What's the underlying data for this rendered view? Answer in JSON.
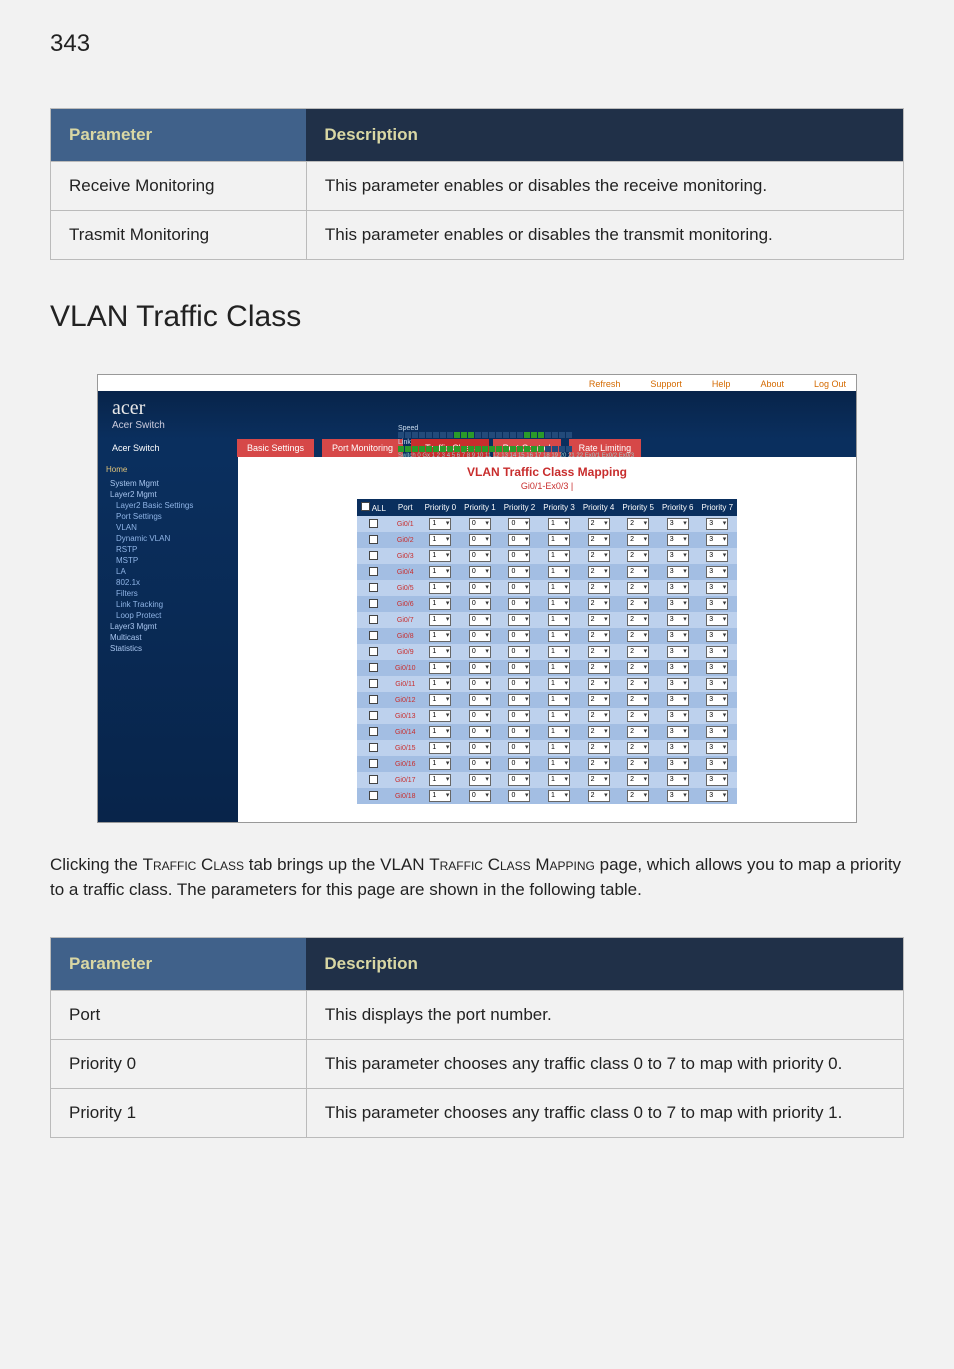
{
  "pageNumber": "343",
  "table1": {
    "headerParam": "Parameter",
    "headerDesc": "Description",
    "rows": [
      {
        "param": "Receive Monitoring",
        "desc": "This parameter enables or disables the receive monitoring."
      },
      {
        "param": "Trasmit Monitoring",
        "desc": "This parameter enables or disables the transmit monitoring."
      }
    ]
  },
  "sectionHeading": "VLAN Traffic Class",
  "screenshot": {
    "topbar": {
      "refresh": "Refresh",
      "support": "Support",
      "help": "Help",
      "about": "About",
      "logout": "Log Out"
    },
    "brand": {
      "line1": "acer",
      "line2": "Acer Switch"
    },
    "portStrip": {
      "speed": "Speed",
      "link": "Link",
      "labels": "Switch 0 Gx 1 2 3 4 5 6 7 8 9 10 11 12 13 14 15 16 17 18 19 20 21 22 Ex0/1 Ex0/2 Ex0/3"
    },
    "tabs": {
      "root": "Acer Switch",
      "basic": "Basic Settings",
      "pm": "Port Monitoring",
      "tc": "Traffic Class",
      "pc": "Port Control",
      "rl": "Rate Limiting"
    },
    "sidebar": {
      "home": "Home",
      "items": [
        "System Mgmt",
        "Layer2 Mgmt"
      ],
      "l2sub": [
        "Layer2 Basic Settings",
        "Port Settings",
        "VLAN",
        "Dynamic VLAN",
        "RSTP",
        "MSTP",
        "LA",
        "802.1x",
        "Filters",
        "Link Tracking",
        "Loop Protect"
      ],
      "l3": "Layer3 Mgmt",
      "mc": "Multicast",
      "st": "Statistics"
    },
    "mapping": {
      "title": "VLAN Traffic Class Mapping",
      "subtitle": "Gi0/1-Ex0/3",
      "allLabel": "ALL",
      "headers": [
        "Port",
        "Priority 0",
        "Priority 1",
        "Priority 2",
        "Priority 3",
        "Priority 4",
        "Priority 5",
        "Priority 6",
        "Priority 7"
      ],
      "rows": [
        {
          "port": "Gi0/1",
          "vals": [
            "1",
            "0",
            "0",
            "1",
            "2",
            "2",
            "3",
            "3"
          ]
        },
        {
          "port": "Gi0/2",
          "vals": [
            "1",
            "0",
            "0",
            "1",
            "2",
            "2",
            "3",
            "3"
          ]
        },
        {
          "port": "Gi0/3",
          "vals": [
            "1",
            "0",
            "0",
            "1",
            "2",
            "2",
            "3",
            "3"
          ]
        },
        {
          "port": "Gi0/4",
          "vals": [
            "1",
            "0",
            "0",
            "1",
            "2",
            "2",
            "3",
            "3"
          ]
        },
        {
          "port": "Gi0/5",
          "vals": [
            "1",
            "0",
            "0",
            "1",
            "2",
            "2",
            "3",
            "3"
          ]
        },
        {
          "port": "Gi0/6",
          "vals": [
            "1",
            "0",
            "0",
            "1",
            "2",
            "2",
            "3",
            "3"
          ]
        },
        {
          "port": "Gi0/7",
          "vals": [
            "1",
            "0",
            "0",
            "1",
            "2",
            "2",
            "3",
            "3"
          ]
        },
        {
          "port": "Gi0/8",
          "vals": [
            "1",
            "0",
            "0",
            "1",
            "2",
            "2",
            "3",
            "3"
          ]
        },
        {
          "port": "Gi0/9",
          "vals": [
            "1",
            "0",
            "0",
            "1",
            "2",
            "2",
            "3",
            "3"
          ]
        },
        {
          "port": "Gi0/10",
          "vals": [
            "1",
            "0",
            "0",
            "1",
            "2",
            "2",
            "3",
            "3"
          ]
        },
        {
          "port": "Gi0/11",
          "vals": [
            "1",
            "0",
            "0",
            "1",
            "2",
            "2",
            "3",
            "3"
          ]
        },
        {
          "port": "Gi0/12",
          "vals": [
            "1",
            "0",
            "0",
            "1",
            "2",
            "2",
            "3",
            "3"
          ]
        },
        {
          "port": "Gi0/13",
          "vals": [
            "1",
            "0",
            "0",
            "1",
            "2",
            "2",
            "3",
            "3"
          ]
        },
        {
          "port": "Gi0/14",
          "vals": [
            "1",
            "0",
            "0",
            "1",
            "2",
            "2",
            "3",
            "3"
          ]
        },
        {
          "port": "Gi0/15",
          "vals": [
            "1",
            "0",
            "0",
            "1",
            "2",
            "2",
            "3",
            "3"
          ]
        },
        {
          "port": "Gi0/16",
          "vals": [
            "1",
            "0",
            "0",
            "1",
            "2",
            "2",
            "3",
            "3"
          ]
        },
        {
          "port": "Gi0/17",
          "vals": [
            "1",
            "0",
            "0",
            "1",
            "2",
            "2",
            "3",
            "3"
          ]
        },
        {
          "port": "Gi0/18",
          "vals": [
            "1",
            "0",
            "0",
            "1",
            "2",
            "2",
            "3",
            "3"
          ]
        }
      ]
    }
  },
  "paragraph": {
    "pre": "Clicking the ",
    "tc1": "Traffic Class",
    "mid": " tab brings up the VLAN ",
    "tc2": "Traffic Class Mapping",
    "post": " page, which allows you to map a priority to a traffic class. The parameters for this page are shown in the following table."
  },
  "table2": {
    "headerParam": "Parameter",
    "headerDesc": "Description",
    "rows": [
      {
        "param": "Port",
        "desc": "This displays the port number."
      },
      {
        "param": "Priority 0",
        "desc": "This parameter chooses any traffic class 0 to 7 to map with priority 0."
      },
      {
        "param": "Priority 1",
        "desc": "This parameter chooses any traffic class 0 to 7 to map with priority 1."
      }
    ]
  }
}
